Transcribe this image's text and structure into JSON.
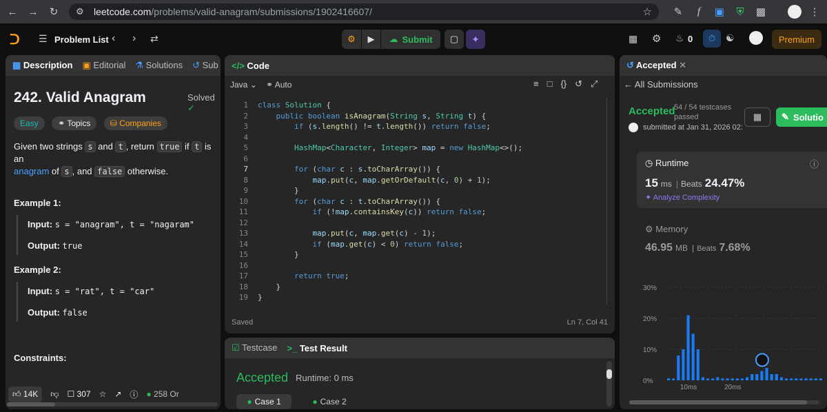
{
  "browser": {
    "url_domain": "leetcode.com",
    "url_path": "/problems/valid-anagram/submissions/1902416607/"
  },
  "nav": {
    "problem_list": "Problem List",
    "submit": "Submit",
    "streak": "0",
    "premium": "Premium"
  },
  "left": {
    "tabs": [
      "Description",
      "Editorial",
      "Solutions",
      "Sub"
    ],
    "title": "242. Valid Anagram",
    "solved": "Solved",
    "tags": [
      "Easy",
      "Topics",
      "Companies"
    ],
    "desc": {
      "p1": "Given two strings ",
      "s": "s",
      "p2": " and ",
      "t": "t",
      "p3": ", return ",
      "true": "true",
      "p4": " if ",
      "p5": " is an",
      "anagram": "anagram",
      "p6": " of ",
      "p7": ", and ",
      "false": "false",
      "p8": " otherwise."
    },
    "examples": [
      {
        "title": "Example 1:",
        "input_label": "Input:",
        "input": "s = \"anagram\", t = \"nagaram\"",
        "output_label": "Output:",
        "output": "true"
      },
      {
        "title": "Example 2:",
        "input_label": "Input:",
        "input": "s = \"rat\", t = \"car\"",
        "output_label": "Output:",
        "output": "false"
      }
    ],
    "constraints": "Constraints:",
    "footer": {
      "likes": "14K",
      "comments": "307",
      "online": "258 Or"
    }
  },
  "code": {
    "tab": "Code",
    "lang": "Java",
    "auto": "Auto",
    "status": "Saved",
    "cursor": "Ln 7, Col 41",
    "lines": [
      "class Solution {",
      "    public boolean isAnagram(String s, String t) {",
      "        if (s.length() != t.length()) return false;",
      "",
      "        HashMap<Character, Integer> map = new HashMap<>();",
      "",
      "        for (char c : s.toCharArray()) {",
      "            map.put(c, map.getOrDefault(c, 0) + 1);",
      "        }",
      "        for (char c : t.toCharArray()) {",
      "            if (!map.containsKey(c)) return false;",
      "",
      "            map.put(c, map.get(c) - 1);",
      "            if (map.get(c) < 0) return false;",
      "        }",
      "",
      "        return true;",
      "    }",
      "}"
    ]
  },
  "test": {
    "tab_testcase": "Testcase",
    "tab_result": "Test Result",
    "status": "Accepted",
    "runtime": "Runtime: 0 ms",
    "cases": [
      "Case 1",
      "Case 2"
    ]
  },
  "result": {
    "tab": "Accepted",
    "all_submissions": "All Submissions",
    "status": "Accepted",
    "testcases": "54 / 54 testcases",
    "passed": "passed",
    "submitted": "submitted at Jan 31, 2026 02:",
    "solution_btn": "Solutio",
    "runtime_label": "Runtime",
    "runtime_value": "15",
    "runtime_unit": "ms",
    "beats_label": "Beats",
    "runtime_beats": "24.47%",
    "analyze": "Analyze Complexity",
    "memory_label": "Memory",
    "memory_value": "46.95",
    "memory_unit": "MB",
    "memory_beats": "7.68%"
  },
  "chart_data": {
    "type": "bar",
    "y_ticks": [
      "30%",
      "20%",
      "10%",
      "0%"
    ],
    "x_ticks": [
      "10ms",
      "20ms"
    ],
    "ylim": [
      0,
      30
    ],
    "values": [
      0.6,
      0.6,
      8,
      10,
      21,
      15,
      10,
      1,
      0.6,
      0.6,
      1,
      0.6,
      0.6,
      0.6,
      0.6,
      0.6,
      1,
      2,
      2,
      3,
      4,
      2,
      2,
      1,
      0.6,
      0.6,
      0.6,
      0.6,
      0.6,
      0.6,
      0.6,
      0.6
    ],
    "marker_index": 19
  }
}
